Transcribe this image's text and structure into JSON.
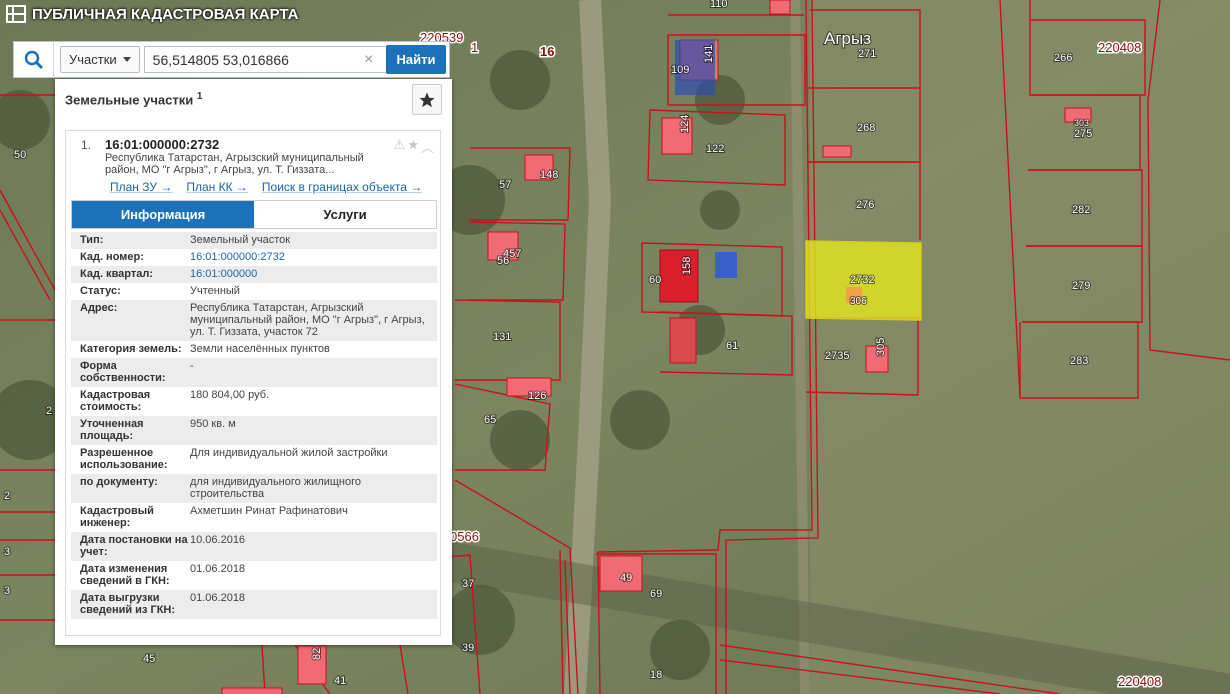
{
  "app": {
    "title": "ПУБЛИЧНАЯ КАДАСТРОВАЯ КАРТА"
  },
  "search": {
    "type_label": "Участки",
    "query": "56,514805 53,016866",
    "clear_label": "×",
    "find_label": "Найти"
  },
  "panel": {
    "title": "Земельные участки",
    "count": "1",
    "result": {
      "index": "1.",
      "number": "16:01:000000:2732",
      "address": "Республика Татарстан, Агрызский муниципальный район, МО \"г Агрыз\", г Агрыз, ул. Т. Гиззата...",
      "links": [
        "План ЗУ →",
        "План КК →",
        "Поиск в границах объекта →"
      ],
      "tabs": [
        "Информация",
        "Услуги"
      ],
      "props": [
        {
          "k": "Тип:",
          "v": "Земельный участок"
        },
        {
          "k": "Кад. номер:",
          "v": "16:01:000000:2732",
          "link": true
        },
        {
          "k": "Кад. квартал:",
          "v": "16:01:000000",
          "link": true
        },
        {
          "k": "Статус:",
          "v": "Учтенный"
        },
        {
          "k": "Адрес:",
          "v": "Республика Татарстан, Агрызский муниципальный район, МО \"г Агрыз\", г Агрыз, ул. Т. Гиззата, участок 72"
        },
        {
          "k": "Категория земель:",
          "v": "Земли населённых пунктов"
        },
        {
          "k": "Форма собственности:",
          "v": "-"
        },
        {
          "k": "Кадастровая стоимость:",
          "v": "180 804,00 руб."
        },
        {
          "k": "Уточненная площадь:",
          "v": "950 кв. м"
        },
        {
          "k": "Разрешенное использование:",
          "v": "Для индивидуальной жилой застройки"
        },
        {
          "k": "по документу:",
          "v": "для индивидуального жилищного строительства"
        },
        {
          "k": "Кадастровый инженер:",
          "v": "Ахметшин Ринат Рафинатович"
        },
        {
          "k": "Дата постановки на учет:",
          "v": "10.06.2016"
        },
        {
          "k": "Дата изменения сведений в ГКН:",
          "v": "01.06.2018"
        },
        {
          "k": "Дата выгрузки сведений из ГКН:",
          "v": "01.06.2018"
        }
      ]
    }
  },
  "map": {
    "place_name": "Агрыз",
    "quarter_labels": [
      "220539",
      "1",
      "16",
      "220408",
      "220408",
      "0566"
    ],
    "plot_labels": [
      "110",
      "271",
      "266",
      "141",
      "109",
      "268",
      "303",
      "275",
      "122",
      "124",
      "148",
      "57",
      "50",
      "276",
      "282",
      "457",
      "56",
      "158",
      "60",
      "2732",
      "306",
      "279",
      "131",
      "61",
      "2735",
      "305",
      "283",
      "126",
      "65",
      "49",
      "69",
      "37",
      "39",
      "45",
      "82",
      "41",
      "18",
      "2",
      "3",
      "2",
      "3"
    ],
    "colors": {
      "selected_fill": "#e3e61e",
      "building_fill": "#f06b74",
      "boundary": "#c8131b"
    }
  }
}
